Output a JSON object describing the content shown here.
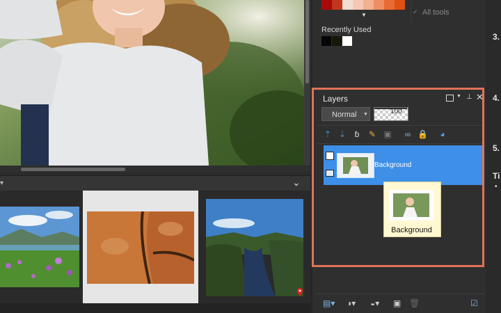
{
  "swatches": {
    "colors": [
      "#a80a0a",
      "#c1371e",
      "#f2ddd3",
      "#f6c9b6",
      "#f4b08f",
      "#ef8e63",
      "#e86a33",
      "#e04f13"
    ],
    "all_tools_label": "All tools"
  },
  "recently_used": {
    "label": "Recently Used",
    "colors": [
      "#050505",
      "#171708",
      "#ffffff"
    ]
  },
  "layers": {
    "title": "Layers",
    "blend_mode": "Normal",
    "opacity": "100",
    "layer_name": "Background",
    "drag_label": "Background"
  },
  "instructions": {
    "steps": [
      "3.",
      "4.",
      "5."
    ],
    "tip": "Ti"
  }
}
